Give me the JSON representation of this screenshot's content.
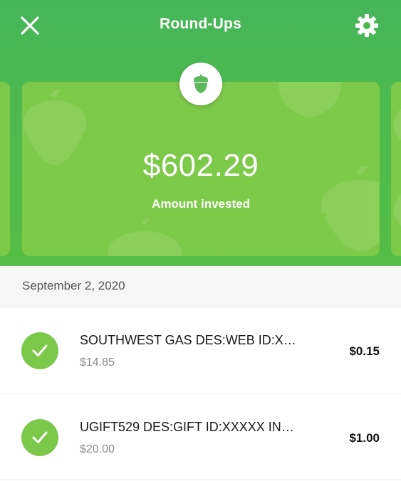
{
  "header": {
    "title": "Round-Ups",
    "close_icon": "close-icon",
    "settings_icon": "gear-icon",
    "badge_icon": "acorn-icon"
  },
  "card": {
    "amount": "$602.29",
    "label": "Amount invested"
  },
  "date_header": "September 2, 2020",
  "transactions": [
    {
      "merchant": "SOUTHWEST GAS DES:WEB ID:X…",
      "purchase": "$14.85",
      "roundup": "$0.15",
      "status_icon": "checkmark-icon"
    },
    {
      "merchant": "UGIFT529 DES:GIFT ID:XXXXX IN…",
      "purchase": "$20.00",
      "roundup": "$1.00",
      "status_icon": "checkmark-icon"
    }
  ],
  "colors": {
    "header_green": "#4dba4f",
    "card_green": "#7dc94a",
    "check_green": "#7cc84a"
  }
}
